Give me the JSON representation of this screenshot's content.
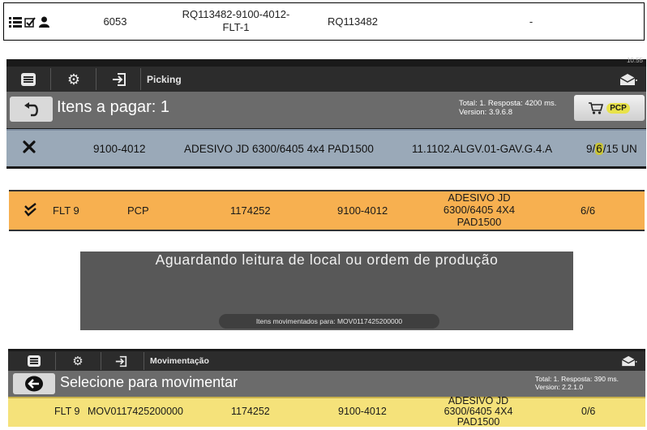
{
  "top_row": {
    "id": "6053",
    "order_code": "RQ113482-9100-4012-FLT-1",
    "order_code_line1": "RQ113482-9100-4012-",
    "order_code_line2": "FLT-1",
    "request": "RQ113482",
    "dash": "-"
  },
  "picking": {
    "status_time": "10:55",
    "toolbar_title": "Picking",
    "items_title": "Itens a pagar: 1",
    "status_line1": "Total: 1. Resposta: 4200 ms.",
    "status_line2": "Version: 3.9.6.8",
    "pcp_label": "PCP",
    "row": {
      "code": "9100-4012",
      "description": "ADESIVO JD 6300/6405 4x4 PAD1500",
      "location": "11.1102.ALGV.01-GAV.G.4.A",
      "qty_a": "9/",
      "qty_b": "6",
      "qty_c": "/15 UN"
    }
  },
  "orange_row": {
    "line": "FLT 9",
    "type": "PCP",
    "order": "1174252",
    "code": "9100-4012",
    "desc_line1": "ADESIVO JD",
    "desc_line2": "6300/6405 4X4",
    "desc_line3": "PAD1500",
    "qty": "6/6"
  },
  "waiting": {
    "message": "Aguardando leitura de local ou ordem de produção",
    "toast": "Itens movimentados para: MOV0117425200000"
  },
  "movimentacao": {
    "toolbar_title": "Movimentação",
    "select_title": "Selecione para movimentar",
    "status_line1": "Total: 1. Resposta: 390 ms.",
    "status_line2": "Version: 2.2.1.0",
    "row": {
      "line": "FLT 9",
      "mov": "MOV0117425200000",
      "order": "1174252",
      "code": "9100-4012",
      "desc_line1": "ADESIVO JD",
      "desc_line2": "6300/6405 4X4",
      "desc_line3": "PAD1500",
      "qty": "0/6"
    }
  },
  "colors": {
    "toolbar": "#2c2c2c",
    "subbar": "#6b6b6b",
    "pick_row": "#9aa9b8",
    "orange_row": "#f7b050",
    "yellow_row": "#f5e27a",
    "highlight": "#e8e24a"
  },
  "icons": [
    "list-icon",
    "checkbox-icon",
    "user-icon",
    "menu-icon",
    "gear-icon",
    "login-icon",
    "mail-icon",
    "back-arrow-icon",
    "cart-icon",
    "close-icon",
    "double-check-icon",
    "left-arrow-circle-icon"
  ]
}
